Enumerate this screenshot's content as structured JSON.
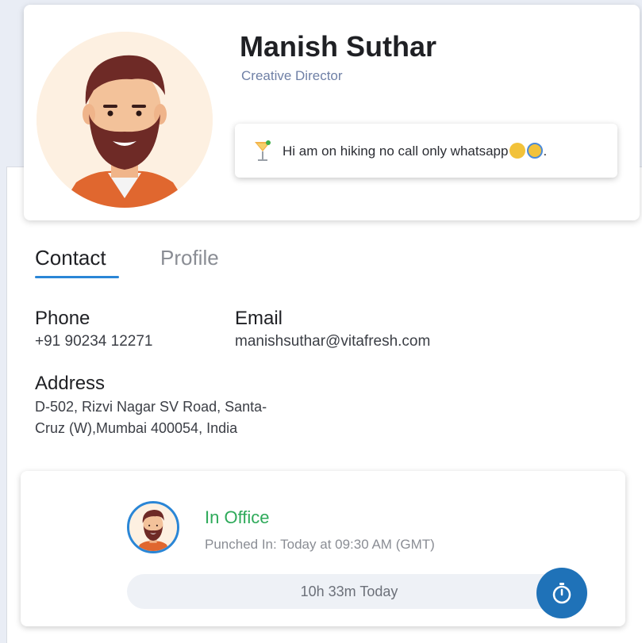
{
  "profile": {
    "name": "Manish Suthar",
    "role": "Creative Director",
    "status_message": "Hi am on hiking no call only whatsapp",
    "status_icon": "cocktail-icon"
  },
  "tabs": [
    {
      "label": "Contact",
      "active": true
    },
    {
      "label": "Profile",
      "active": false
    }
  ],
  "contact": {
    "phone_label": "Phone",
    "phone_value": "+91 90234 12271",
    "email_label": "Email",
    "email_value": "manishsuthar@vitafresh.com",
    "address_label": "Address",
    "address_line1": "D-502, Rizvi Nagar SV Road, Santa-",
    "address_line2": "Cruz (W),Mumbai 400054, India"
  },
  "attendance": {
    "status": "In Office",
    "punched_in": "Punched In: Today at 09:30 AM (GMT)",
    "duration": "10h 33m Today",
    "timer_icon": "stopwatch-icon"
  },
  "colors": {
    "accent": "#2a86d6",
    "status_green": "#2eaa5a",
    "timer_button": "#1f72b8",
    "role_text": "#6f80a6"
  }
}
